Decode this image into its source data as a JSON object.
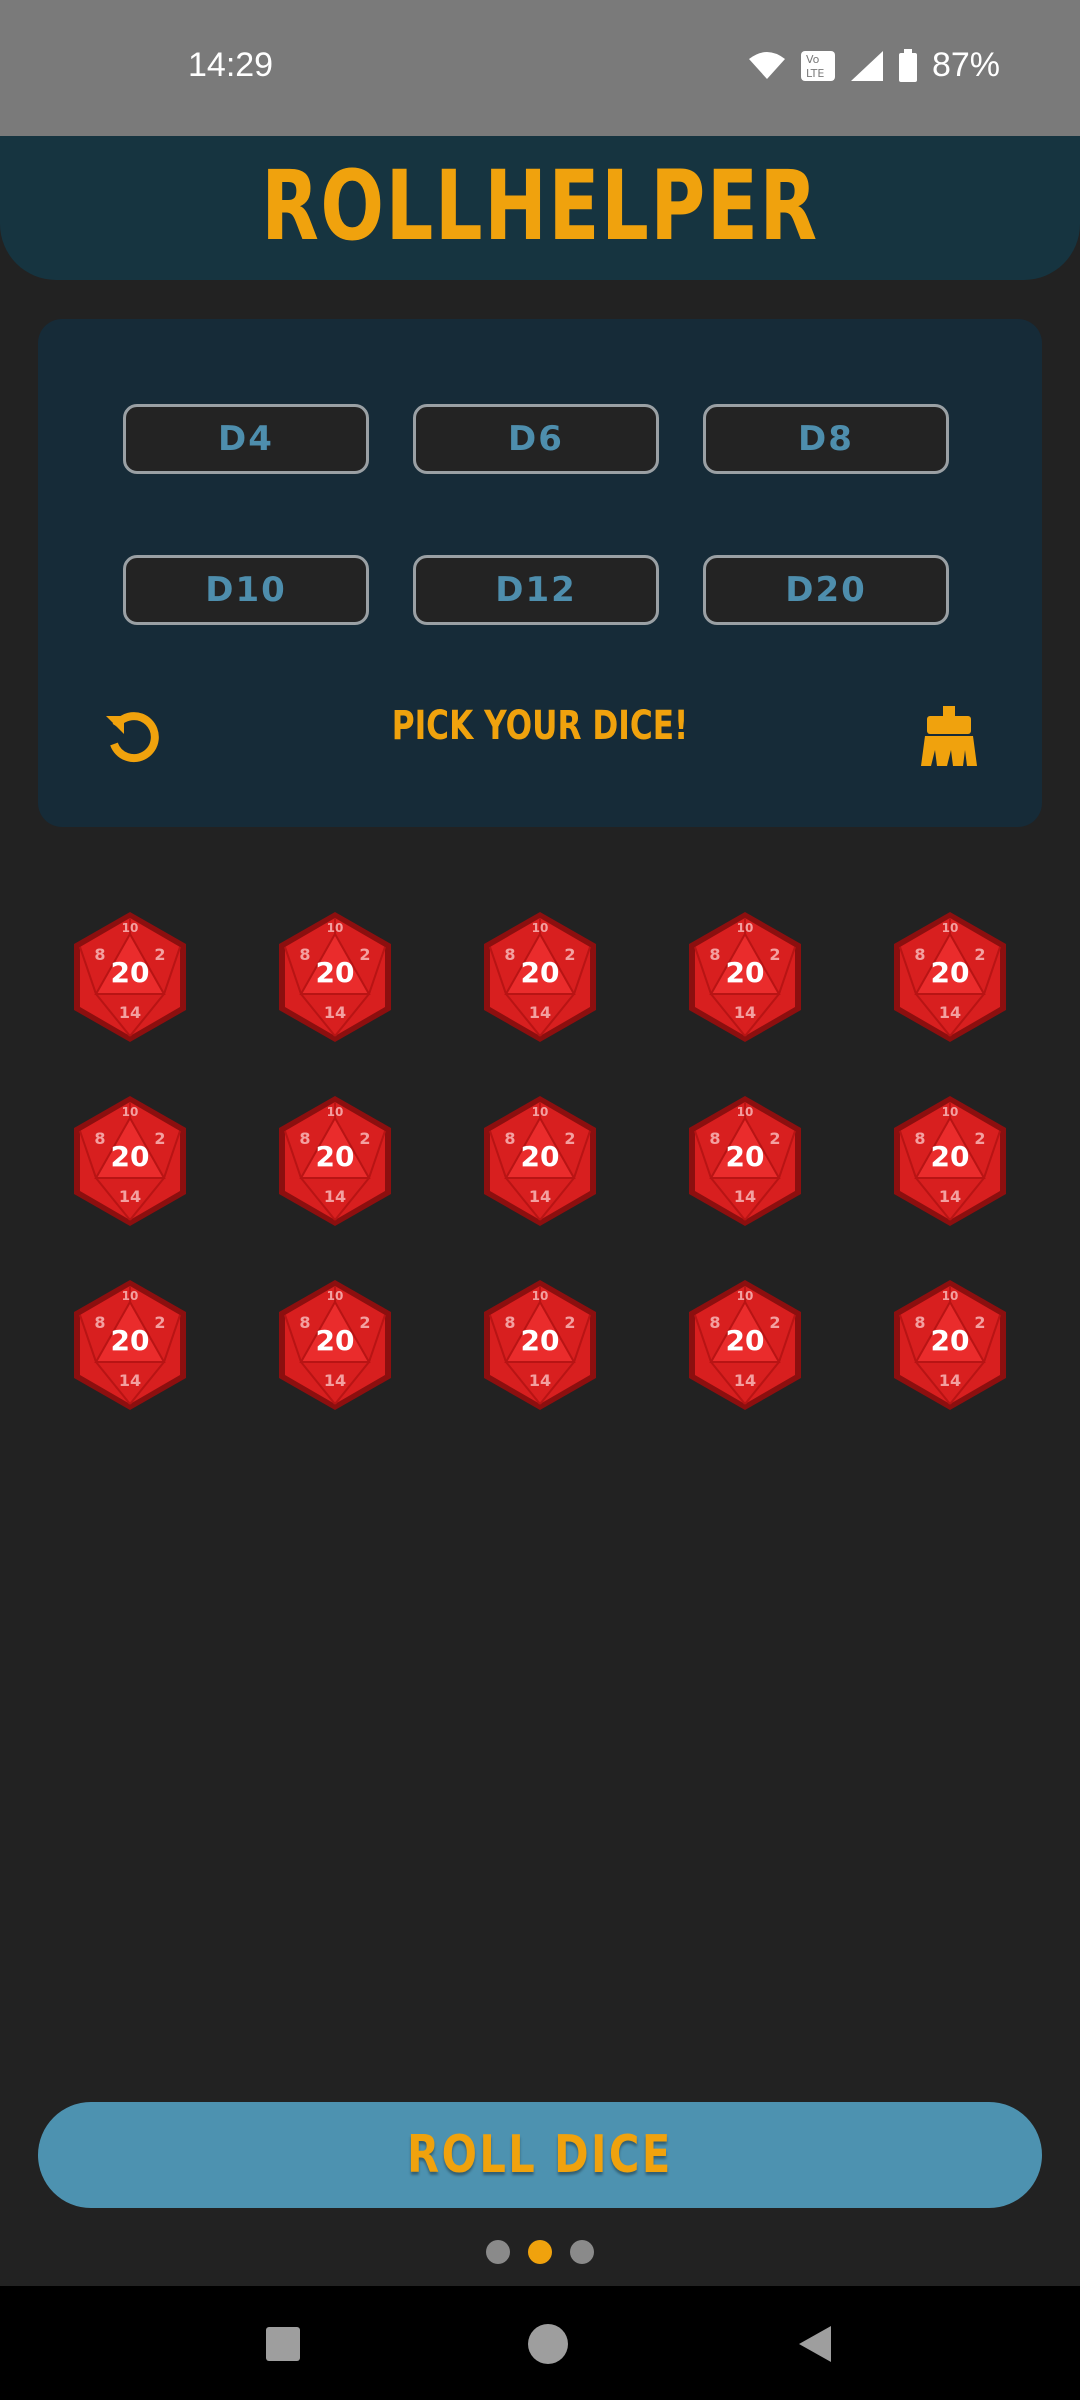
{
  "status_bar": {
    "time": "14:29",
    "battery": "87%",
    "icons": [
      "wifi-icon",
      "volte-icon",
      "signal-icon",
      "battery-icon"
    ]
  },
  "header": {
    "title": "ROLLHELPER"
  },
  "dice_picker": {
    "buttons": [
      {
        "label": "D4"
      },
      {
        "label": "D6"
      },
      {
        "label": "D8"
      },
      {
        "label": "D10"
      },
      {
        "label": "D12"
      },
      {
        "label": "D20"
      }
    ],
    "prompt": "PICK YOUR DICE!",
    "left_icon": "undo-icon",
    "right_icon": "broom-icon"
  },
  "selected_dice": {
    "type": "D20",
    "count": 15,
    "face_top": "20",
    "face_small": [
      "8",
      "2",
      "14",
      "10"
    ]
  },
  "roll_button": {
    "label": "ROLL DICE"
  },
  "pager": {
    "pages": 3,
    "active": 2
  },
  "colors": {
    "accent": "#f0a20d",
    "panel": "#162b38",
    "header": "#163440",
    "button_text": "#4e8ead",
    "roll_button": "#4d92b0",
    "die_red": "#d81f1f",
    "background": "#222222"
  }
}
